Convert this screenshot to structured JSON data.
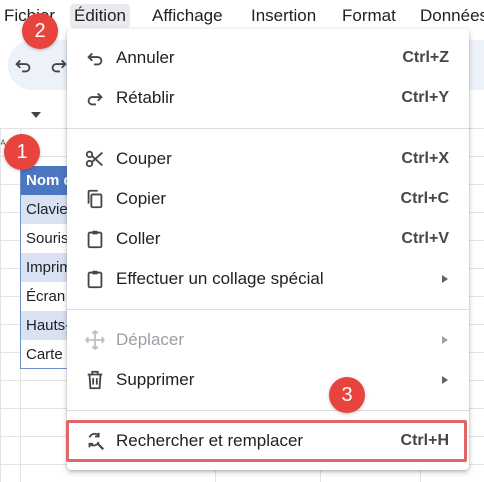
{
  "menubar": {
    "items": [
      "Fichier",
      "Édition",
      "Affichage",
      "Insertion",
      "Format",
      "Données"
    ]
  },
  "spreadsheet": {
    "column_label": "A",
    "header_cell": "Nom du",
    "rows": [
      "Clavier",
      "Souris",
      "Imprimante",
      "Écran",
      "Hauts-parleurs",
      "Carte"
    ]
  },
  "menu": {
    "undo": {
      "label": "Annuler",
      "shortcut": "Ctrl+Z",
      "icon": "undo-icon"
    },
    "redo": {
      "label": "Rétablir",
      "shortcut": "Ctrl+Y",
      "icon": "redo-icon"
    },
    "cut": {
      "label": "Couper",
      "shortcut": "Ctrl+X",
      "icon": "scissors-icon"
    },
    "copy": {
      "label": "Copier",
      "shortcut": "Ctrl+C",
      "icon": "copy-icon"
    },
    "paste": {
      "label": "Coller",
      "shortcut": "Ctrl+V",
      "icon": "clipboard-icon"
    },
    "paste_special": {
      "label": "Effectuer un collage spécial",
      "icon": "clipboard-icon"
    },
    "move": {
      "label": "Déplacer",
      "icon": "move-icon"
    },
    "delete": {
      "label": "Supprimer",
      "icon": "trash-icon"
    },
    "find_replace": {
      "label": "Rechercher et remplacer",
      "shortcut": "Ctrl+H",
      "icon": "find-replace-icon"
    }
  },
  "annotations": [
    "1",
    "2",
    "3"
  ],
  "colors": {
    "badge": "#e8433d",
    "highlight_border": "#e06666",
    "header_fill": "#4a76c2",
    "row_tint": "#d8e2f3",
    "toolbar_bg": "#edf2fa"
  }
}
